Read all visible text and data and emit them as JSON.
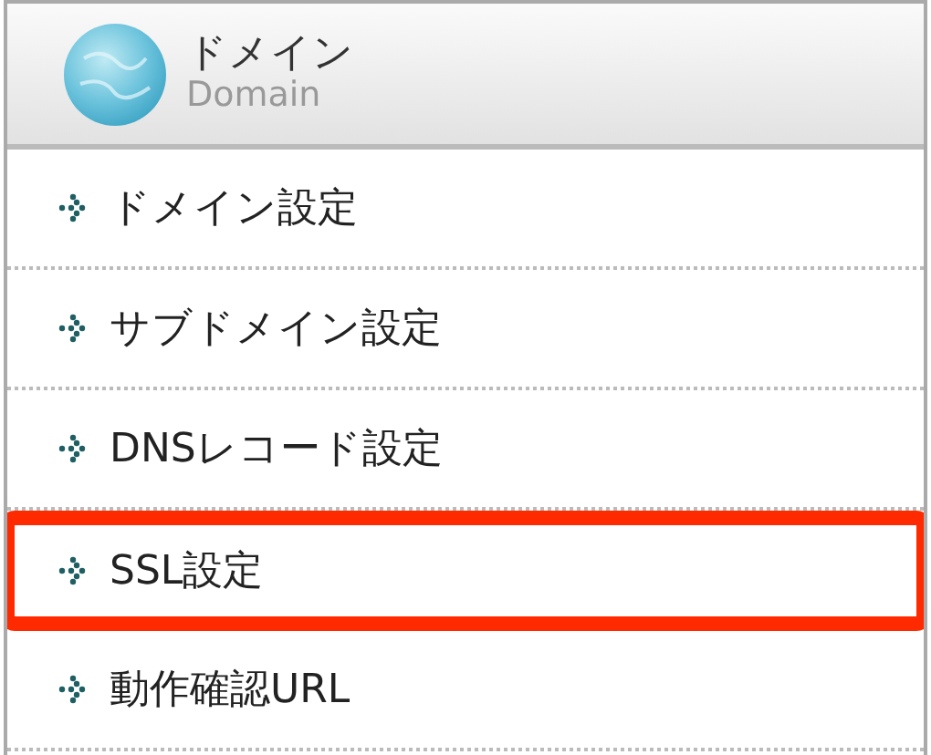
{
  "header": {
    "title": "ドメイン",
    "subtitle": "Domain"
  },
  "menu": [
    {
      "label": "ドメイン設定",
      "highlighted": false
    },
    {
      "label": "サブドメイン設定",
      "highlighted": false
    },
    {
      "label": "DNSレコード設定",
      "highlighted": false
    },
    {
      "label": "SSL設定",
      "highlighted": true
    },
    {
      "label": "動作確認URL",
      "highlighted": false
    }
  ]
}
